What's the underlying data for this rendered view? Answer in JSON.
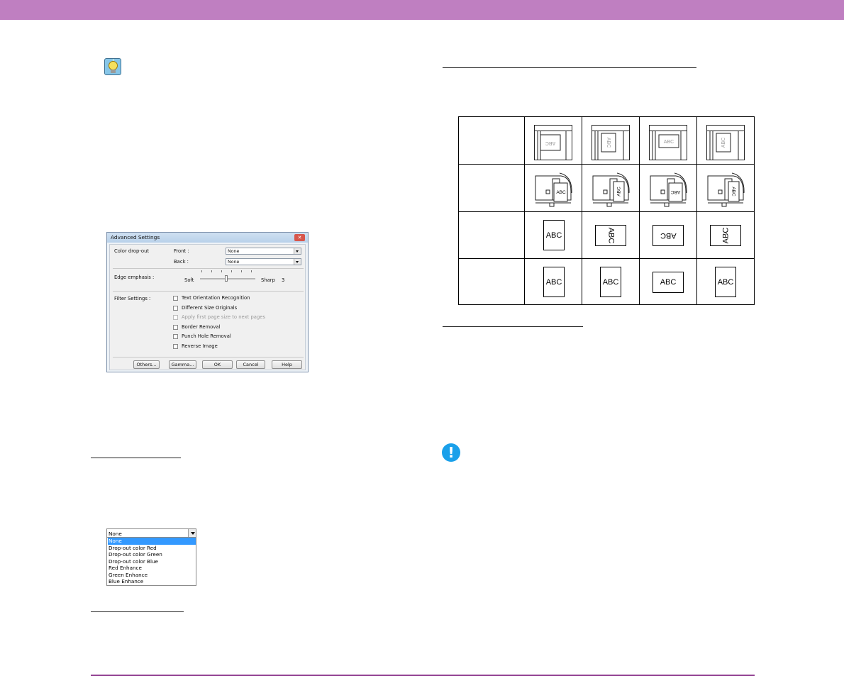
{
  "dialog": {
    "title": "Advanced Settings",
    "close_label": "✕",
    "color_dropout_label": "Color drop-out",
    "front_label": "Front :",
    "front_value": "None",
    "back_label": "Back :",
    "back_value": "None",
    "edge_emphasis_label": "Edge emphasis :",
    "soft_label": "Soft",
    "sharp_label": "Sharp",
    "edge_value": "3",
    "edge_level": 3,
    "edge_level_max": 6,
    "filter_settings_label": "Filter Settings :",
    "checkboxes": [
      {
        "label": "Text Orientation Recognition",
        "checked": false,
        "disabled": false
      },
      {
        "label": "Different Size Originals",
        "checked": false,
        "disabled": false
      },
      {
        "label": "Apply first page size to next pages",
        "checked": false,
        "disabled": true
      },
      {
        "label": "Border Removal",
        "checked": false,
        "disabled": false
      },
      {
        "label": "Punch Hole Removal",
        "checked": false,
        "disabled": false
      },
      {
        "label": "Reverse Image",
        "checked": false,
        "disabled": false
      }
    ],
    "buttons": {
      "others": "Others...",
      "gamma": "Gamma...",
      "ok": "OK",
      "cancel": "Cancel",
      "help": "Help"
    }
  },
  "dropdown": {
    "selected_value": "None",
    "options": [
      "None",
      "Drop-out color Red",
      "Drop-out color Green",
      "Drop-out color Blue",
      "Red Enhance",
      "Green Enhance",
      "Blue Enhance"
    ]
  },
  "orientation_table": {
    "doc_label": "ABC",
    "row_labels": [
      "",
      "",
      "",
      ""
    ]
  },
  "colors": {
    "header_bar": "#bf7fc1",
    "footer_rule": "#8f3c8f",
    "caution_icon": "#1aa0ea",
    "selected_option": "#3399ff"
  },
  "icons": {
    "tip": "lightbulb-tip-icon",
    "caution": "exclamation-caution-icon"
  }
}
